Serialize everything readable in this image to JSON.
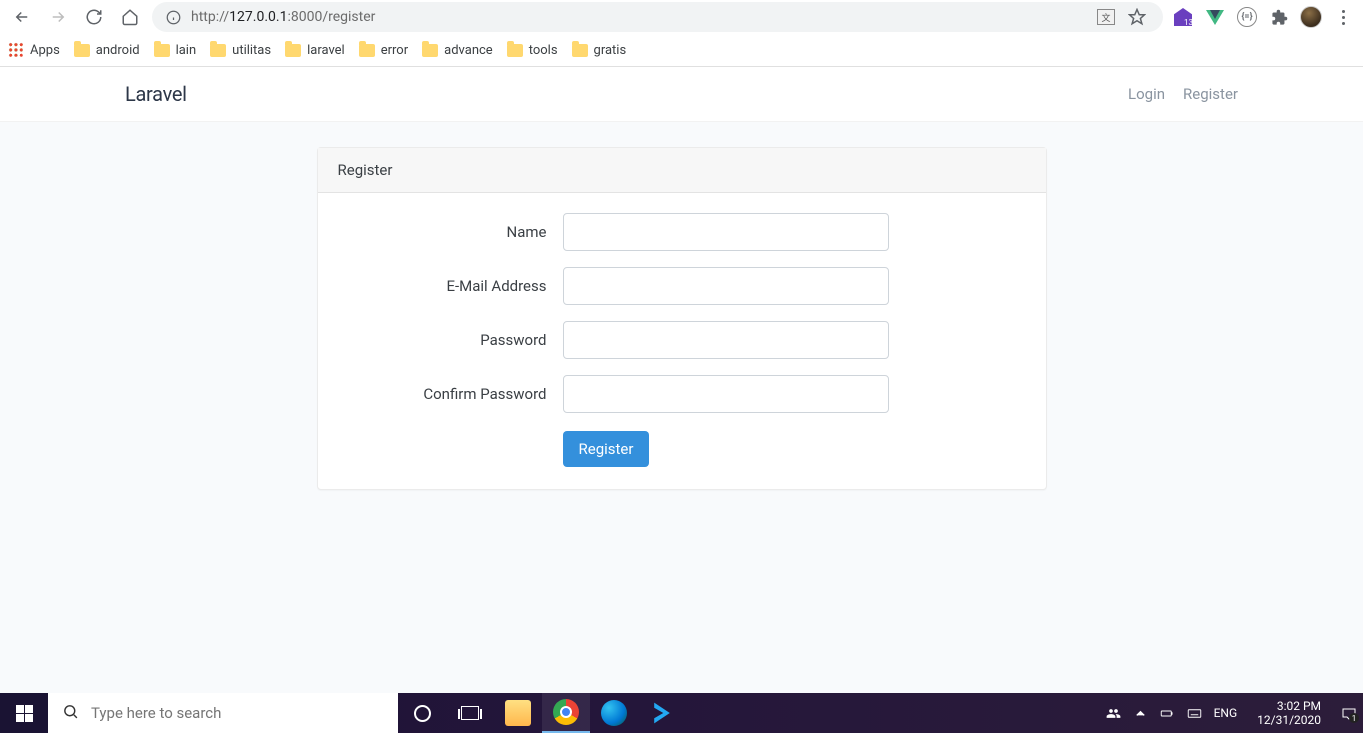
{
  "browser": {
    "url_prefix": "http://",
    "url_host": "127.0.0.1",
    "url_port_path": ":8000/register"
  },
  "bookmarks": {
    "apps_label": "Apps",
    "items": [
      "android",
      "lain",
      "utilitas",
      "laravel",
      "error",
      "advance",
      "tools",
      "gratis"
    ]
  },
  "navbar": {
    "brand": "Laravel",
    "login_label": "Login",
    "register_label": "Register"
  },
  "card": {
    "header": "Register",
    "fields": {
      "name_label": "Name",
      "email_label": "E-Mail Address",
      "password_label": "Password",
      "confirm_label": "Confirm Password"
    },
    "submit_label": "Register"
  },
  "taskbar": {
    "search_placeholder": "Type here to search",
    "lang": "ENG",
    "time": "3:02 PM",
    "date": "12/31/2020",
    "notif_count": "1"
  },
  "extensions": {
    "badge_number": "13",
    "braces": "{=}"
  }
}
